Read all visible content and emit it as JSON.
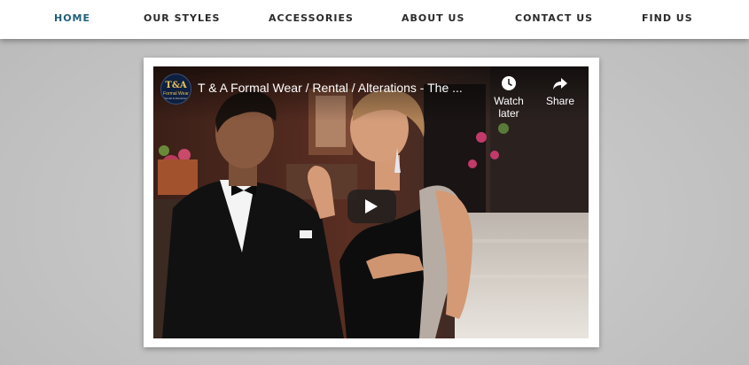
{
  "nav": {
    "items": [
      {
        "label": "HOME",
        "active": true
      },
      {
        "label": "OUR STYLES",
        "active": false
      },
      {
        "label": "ACCESSORIES",
        "active": false
      },
      {
        "label": "ABOUT US",
        "active": false
      },
      {
        "label": "CONTACT US",
        "active": false
      },
      {
        "label": "FIND US",
        "active": false
      }
    ],
    "active_color": "#1f5f7a",
    "text_color": "#2a2a2a"
  },
  "video": {
    "channel_logo": {
      "main": "T&A",
      "sub": "Formal Wear",
      "tag": "Rental & Alterations"
    },
    "title": "T & A Formal Wear / Rental / Alterations - The ...",
    "watch_later_label": "Watch later",
    "watch_later_icon": "clock-icon",
    "share_label": "Share",
    "share_icon": "share-arrow-icon",
    "play_icon": "play-icon"
  }
}
